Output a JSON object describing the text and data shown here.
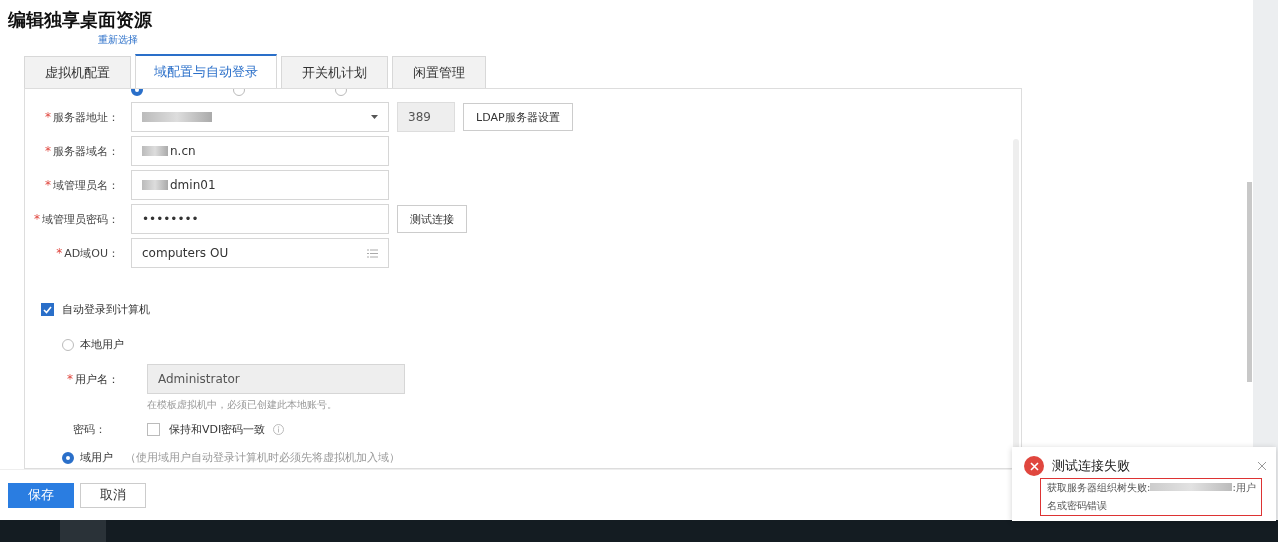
{
  "page": {
    "title": "编辑独享桌面资源",
    "reselect_link": "重新选择"
  },
  "tabs": [
    {
      "label": "虚拟机配置",
      "selected": false
    },
    {
      "label": "域配置与自动登录",
      "selected": true
    },
    {
      "label": "开关机计划",
      "selected": false
    },
    {
      "label": "闲置管理",
      "selected": false
    }
  ],
  "protocol_options": [
    {
      "selected": true
    },
    {
      "selected": false
    },
    {
      "selected": false
    }
  ],
  "fields": [
    {
      "kind": "select",
      "required_mark": "*",
      "label": "服务器地址：",
      "masked": true,
      "port": "389",
      "button": "LDAP服务器设置"
    },
    {
      "kind": "text",
      "required_mark": "*",
      "label": "服务器域名：",
      "masked": true,
      "value": "n.cn"
    },
    {
      "kind": "text",
      "required_mark": "*",
      "label": "域管理员名：",
      "masked": true,
      "value": "dmin01"
    },
    {
      "kind": "text",
      "required_mark": "*",
      "label": "域管理员密码：",
      "value": "••••••••",
      "button": "测试连接"
    },
    {
      "kind": "list",
      "required_mark": "*",
      "label": "AD域OU：",
      "value": "computers OU"
    }
  ],
  "auto_login": {
    "label": "自动登录到计算机",
    "checked": true
  },
  "user_types": [
    {
      "label": "本地用户",
      "selected": false
    },
    {
      "label": "域用户",
      "selected": true,
      "note": "（使用域用户自动登录计算机时必须先将虚拟机加入域）"
    }
  ],
  "local_user": {
    "required_mark": "*",
    "username_label": "用户名：",
    "username": "Administrator",
    "disabled": true,
    "hint": "在模板虚拟机中，必须已创建此本地账号。",
    "password_label": "密码：",
    "keep_label": "保持和VDI密码一致",
    "keep_checked": false
  },
  "footer_buttons": [
    {
      "label": "保存",
      "kind": "primary"
    },
    {
      "label": "取消",
      "kind": "default"
    }
  ],
  "toast": {
    "kind": "error",
    "title": "测试连接失败",
    "message_prefix": "获取服务器组织树失败:",
    "masked": true,
    "message_suffix": ":用户名或密码错误",
    "highlighted": true
  }
}
